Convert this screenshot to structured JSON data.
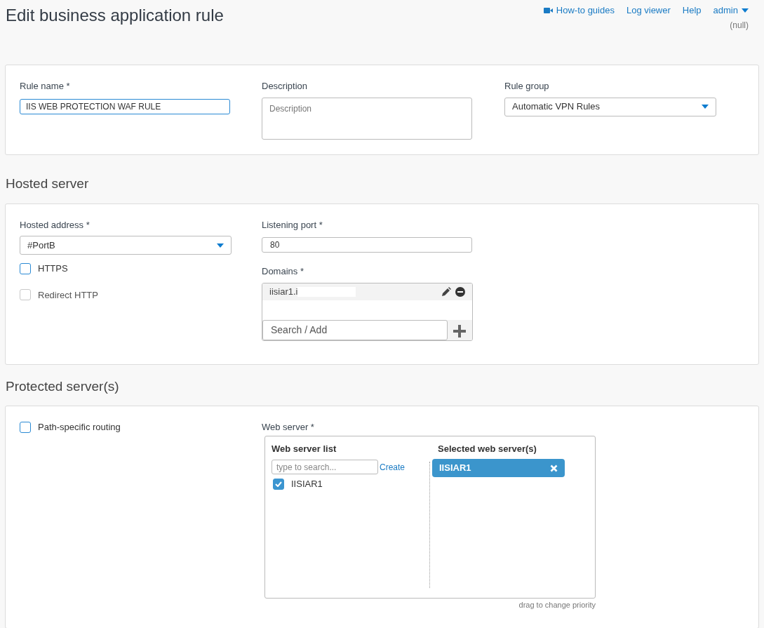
{
  "page_title": "Edit business application rule",
  "top_links": [
    {
      "kind": "video",
      "label": "How-to guides"
    },
    {
      "kind": "plain",
      "label": "Log viewer"
    },
    {
      "kind": "plain",
      "label": "Help"
    },
    {
      "kind": "menu",
      "label": "admin"
    }
  ],
  "user_note": "(null)",
  "general": {
    "rule_name": {
      "label": "Rule name *",
      "value": "IIS WEB PROTECTION WAF RULE"
    },
    "description": {
      "label": "Description",
      "placeholder": "Description"
    },
    "rule_group": {
      "label": "Rule group",
      "value": "Automatic VPN Rules"
    }
  },
  "hosted_server": {
    "heading": "Hosted server",
    "hosted_address": {
      "label": "Hosted address *",
      "value": "#PortB"
    },
    "options": [
      {
        "label": "HTTPS",
        "checked": false,
        "disabled": false
      },
      {
        "label": "Redirect HTTP",
        "checked": false,
        "disabled": true
      }
    ],
    "listening_port": {
      "label": "Listening port *",
      "value": "80"
    },
    "domains": {
      "label": "Domains *",
      "items": [
        "iisiar1.i"
      ],
      "placeholder": "Search / Add"
    }
  },
  "protected_servers": {
    "heading": "Protected server(s)",
    "path_routing": {
      "label": "Path-specific routing",
      "checked": false,
      "disabled": false
    },
    "web_server": {
      "label": "Web server *",
      "list_title": "Web server list",
      "search_placeholder": "type to search...",
      "create": "Create",
      "list": [
        {
          "name": "IISIAR1",
          "checked": true
        }
      ],
      "selected_title": "Selected web server(s)",
      "selected": [
        "IISIAR1"
      ],
      "hint": "drag to change priority"
    }
  }
}
